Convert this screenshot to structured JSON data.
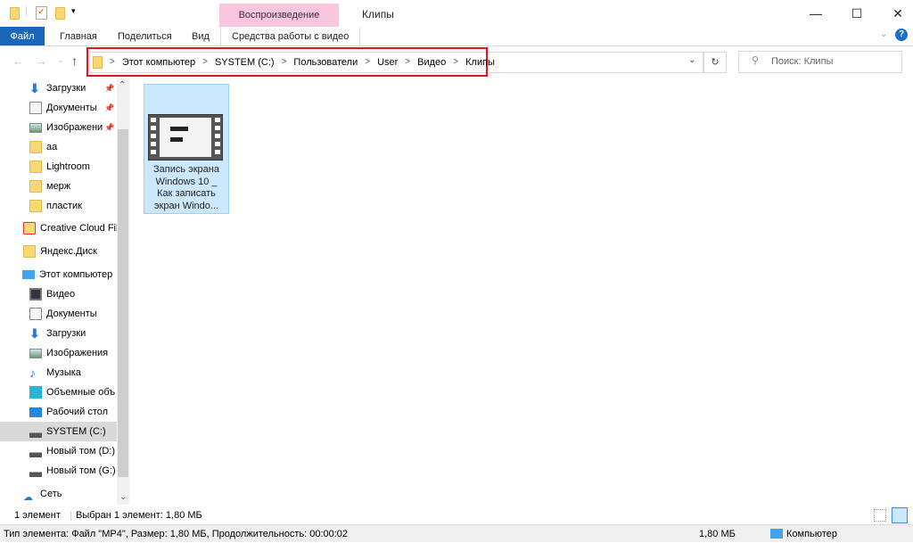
{
  "window": {
    "title": "Клипы",
    "context_tab": "Воспроизведение",
    "minimize": "—",
    "maximize": "☐",
    "close": "✕"
  },
  "ribbon": {
    "tabs": [
      "Файл",
      "Главная",
      "Поделиться",
      "Вид",
      "Средства работы с видео"
    ]
  },
  "address": {
    "crumbs": [
      "Этот компьютер",
      "SYSTEM (C:)",
      "Пользователи",
      "User",
      "Видео",
      "Клипы"
    ],
    "search_placeholder": "Поиск: Клипы"
  },
  "nav": {
    "quick": [
      {
        "label": "Загрузки",
        "icon": "download-icon",
        "pinned": true
      },
      {
        "label": "Документы",
        "icon": "documents-icon",
        "pinned": true
      },
      {
        "label": "Изображени",
        "icon": "pictures-icon",
        "pinned": true
      },
      {
        "label": "aa",
        "icon": "folder-icon"
      },
      {
        "label": "Lightroom",
        "icon": "folder-icon"
      },
      {
        "label": "мерж",
        "icon": "folder-icon"
      },
      {
        "label": "пластик",
        "icon": "folder-icon"
      }
    ],
    "creative": "Creative Cloud Fil",
    "yandex": "Яндекс.Диск",
    "pc": "Этот компьютер",
    "pc_items": [
      {
        "label": "Видео",
        "icon": "video-icon"
      },
      {
        "label": "Документы",
        "icon": "documents-icon"
      },
      {
        "label": "Загрузки",
        "icon": "download-icon"
      },
      {
        "label": "Изображения",
        "icon": "pictures-icon"
      },
      {
        "label": "Музыка",
        "icon": "music-icon"
      },
      {
        "label": "Объемные объ",
        "icon": "3d-objects-icon"
      },
      {
        "label": "Рабочий стол",
        "icon": "desktop-icon"
      },
      {
        "label": "SYSTEM (C:)",
        "icon": "system-drive-icon",
        "selected": true
      },
      {
        "label": "Новый том (D:)",
        "icon": "drive-icon"
      },
      {
        "label": "Новый том (G:)",
        "icon": "drive-icon"
      }
    ],
    "network": "Сеть"
  },
  "files": [
    {
      "name": "Запись экрана Windows 10 _ Как записать экран Windo...",
      "lines": [
        "Запись экрана",
        "Windows 10 _",
        "Как записать",
        "экран Windo..."
      ],
      "selected": true
    }
  ],
  "status": {
    "count": "1 элемент",
    "selected": "Выбран 1 элемент: 1,80 МБ"
  },
  "details_bar": {
    "info": "Тип элемента: Файл \"MP4\", Размер: 1,80 МБ, Продолжительность: 00:00:02",
    "size": "1,80 МБ",
    "location": "Компьютер"
  },
  "colors": {
    "accent": "#1a66b8",
    "context_tab": "#f9c6de",
    "highlight": "#e8121e",
    "selection": "#cce8ff"
  }
}
